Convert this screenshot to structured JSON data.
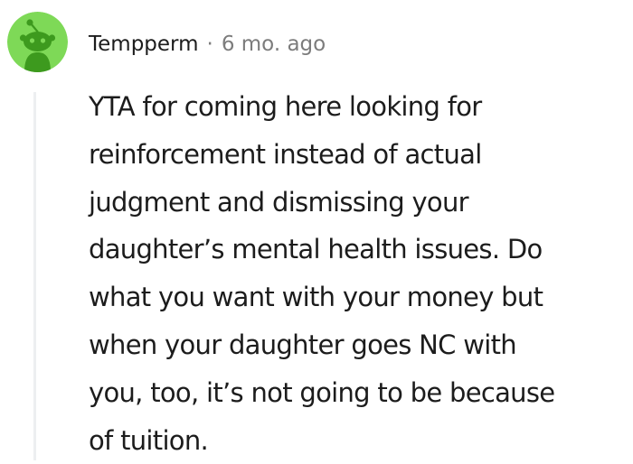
{
  "comment": {
    "avatar_icon": "reddit-snoo-avatar",
    "avatar_color": "#7ed957",
    "username": "Tempperm",
    "separator": "·",
    "timestamp": "6 mo. ago",
    "body_lines": [
      "YTA for coming here looking for",
      "reinforcement instead of actual",
      "judgment and dismissing your",
      "daughter’s mental health issues. Do",
      "what you want with your money but",
      "when your daughter goes NC with",
      "you, too, it’s not going to be because",
      "of tuition."
    ]
  }
}
